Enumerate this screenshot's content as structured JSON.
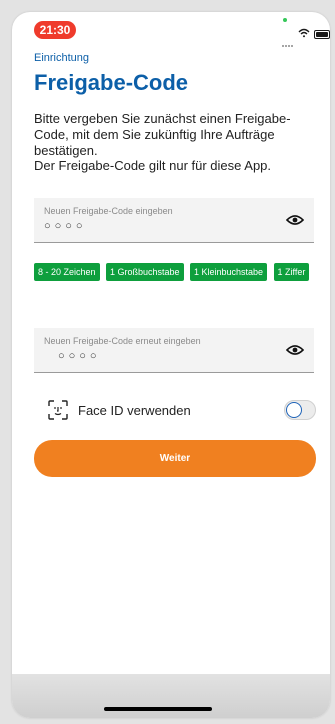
{
  "status_bar": {
    "time": "21:30"
  },
  "header": {
    "section": "Einrichtung",
    "title": "Freigabe-Code"
  },
  "intro": {
    "text1": "Bitte vergeben Sie zunächst einen Freigabe-Code, mit dem Sie zukünftig Ihre Aufträge bestätigen.",
    "text2": "Der Freigabe-Code gilt nur für diese App."
  },
  "new_code_field": {
    "label": "Neuen Freigabe-Code eingeben",
    "masked_value": "○○○○"
  },
  "requirements": [
    "8 - 20 Zeichen",
    "1 Großbuchstabe",
    "1 Kleinbuchstabe",
    "1 Ziffer"
  ],
  "repeat_code_field": {
    "label": "Neuen Freigabe-Code erneut eingeben",
    "masked_value": "○○○○"
  },
  "face_id": {
    "label": "Face ID verwenden",
    "enabled": false
  },
  "actions": {
    "continue_label": "Weiter"
  },
  "colors": {
    "brand_blue": "#0c5fa8",
    "requirement_green": "#0e9f3d",
    "button_orange": "#f08020",
    "time_pill": "#ef3b2c"
  },
  "icons": [
    "eye-icon",
    "face-id-icon",
    "wifi-icon",
    "battery-icon"
  ]
}
